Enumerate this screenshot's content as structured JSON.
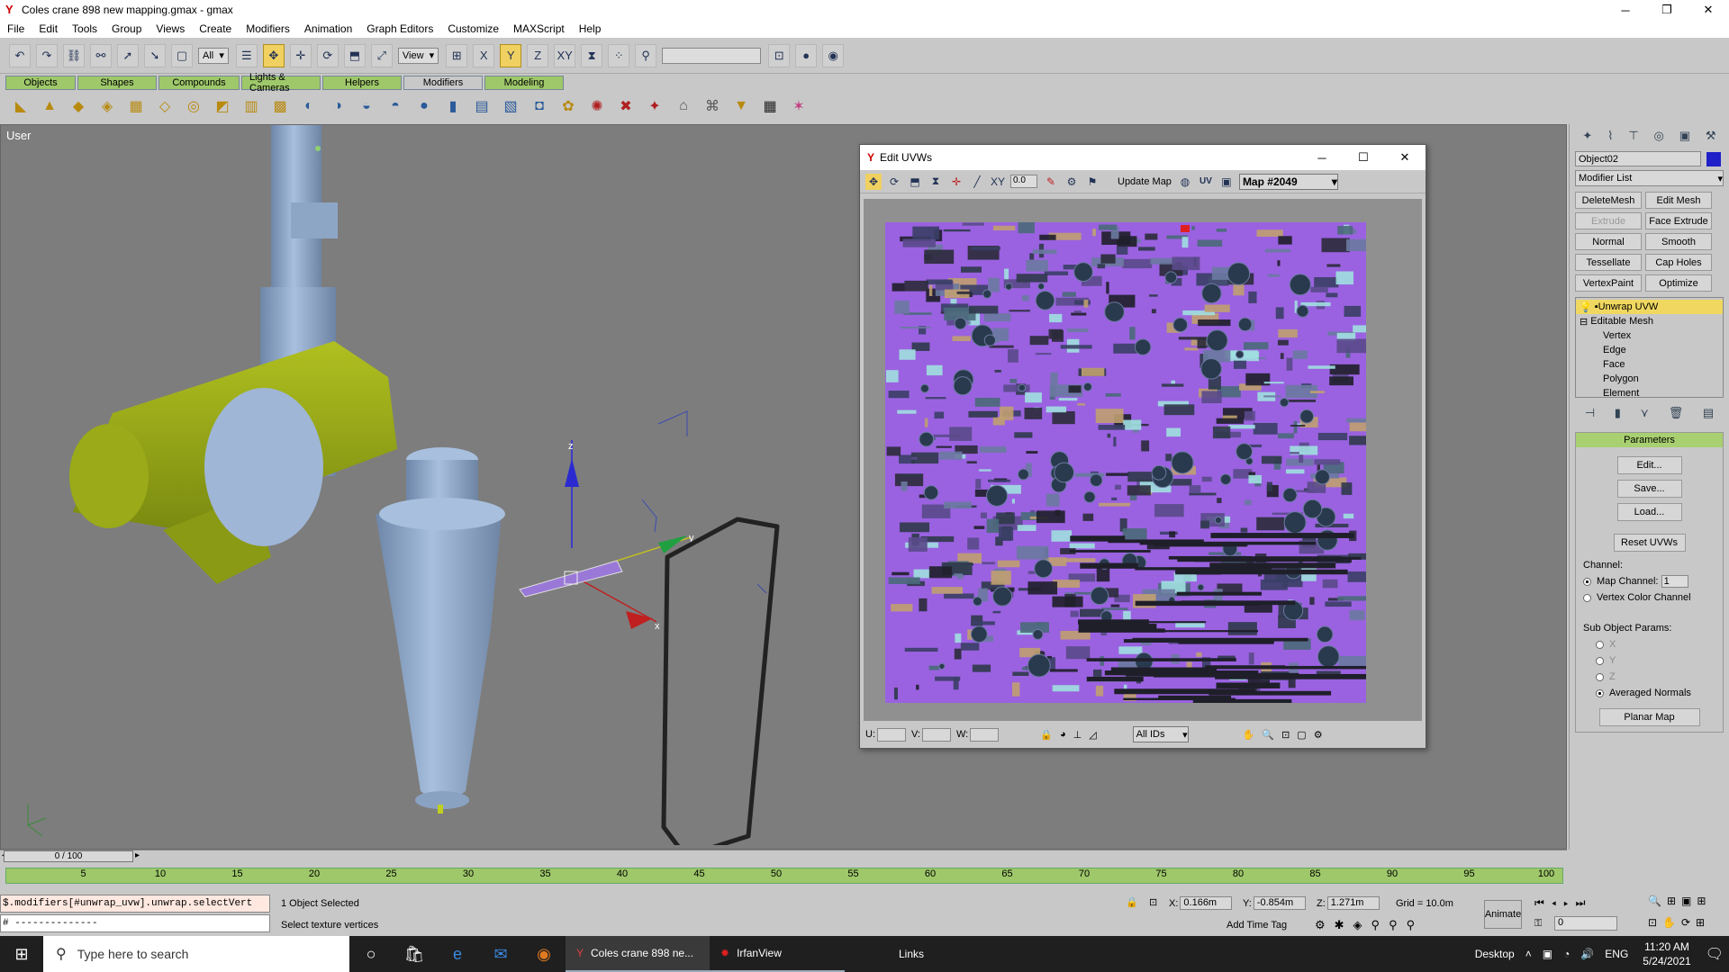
{
  "window": {
    "title": "Coles crane 898 new mapping.gmax - gmax"
  },
  "menu": [
    "File",
    "Edit",
    "Tools",
    "Group",
    "Views",
    "Create",
    "Modifiers",
    "Animation",
    "Graph Editors",
    "Customize",
    "MAXScript",
    "Help"
  ],
  "toolbar": {
    "selection_filter": "All",
    "coord_system": "View"
  },
  "tabs": [
    "Objects",
    "Shapes",
    "Compounds",
    "Lights & Cameras",
    "Helpers",
    "Modifiers",
    "Modeling"
  ],
  "viewport": {
    "label": "User",
    "axes": {
      "x": "x",
      "y": "y",
      "z": "z"
    }
  },
  "command_panel": {
    "object_name": "Object02",
    "object_color": "#2020c8",
    "modifier_list": "Modifier List",
    "buttons": [
      "DeleteMesh",
      "Edit Mesh",
      "Extrude",
      "Face Extrude",
      "Normal",
      "Smooth",
      "Tessellate",
      "Cap Holes",
      "VertexPaint",
      "Optimize"
    ],
    "stack": [
      "Unwrap UVW",
      "Editable Mesh",
      "Vertex",
      "Edge",
      "Face",
      "Polygon",
      "Element"
    ],
    "rollout_title": "Parameters",
    "param_buttons": [
      "Edit...",
      "Save...",
      "Load..."
    ],
    "reset_button": "Reset UVWs",
    "channel": {
      "label": "Channel:",
      "map_channel": "Map Channel:",
      "map_channel_value": "1",
      "vertex_color": "Vertex Color Channel"
    },
    "sub_object": {
      "label": "Sub Object Params:",
      "options": [
        "X",
        "Y",
        "Z",
        "Averaged Normals"
      ],
      "planar": "Planar Map"
    }
  },
  "uvw_editor": {
    "title": "Edit UVWs",
    "spinner": "0.0",
    "update_map": "Update Map",
    "uv_label": "UV",
    "map": "Map #2049",
    "u": "U:",
    "v": "V:",
    "w": "W:",
    "ids": "All IDs"
  },
  "timeline": {
    "frame": "0 / 100",
    "ticks": [
      "5",
      "10",
      "15",
      "20",
      "25",
      "30",
      "35",
      "40",
      "45",
      "50",
      "55",
      "60",
      "65",
      "70",
      "75",
      "80",
      "85",
      "90",
      "95",
      "100"
    ]
  },
  "status": {
    "script_line1": "$.modifiers[#unwrap_uvw].unwrap.selectVert",
    "script_line2": "# --------------",
    "selection": "1 Object Selected",
    "prompt": "Select texture vertices",
    "x_label": "X:",
    "x": "0.166m",
    "y_label": "Y:",
    "y": "-0.854m",
    "z_label": "Z:",
    "z": "1.271m",
    "grid": "Grid = 10.0m",
    "add_time_tag": "Add Time Tag",
    "animate": "Animate",
    "frame_field": "0"
  },
  "taskbar": {
    "search": "Type here to search",
    "apps": [
      "Coles crane 898 ne...",
      "IrfanView"
    ],
    "links": "Links",
    "desktop": "Desktop",
    "lang": "ENG",
    "time": "11:20 AM",
    "date": "5/24/2021"
  }
}
